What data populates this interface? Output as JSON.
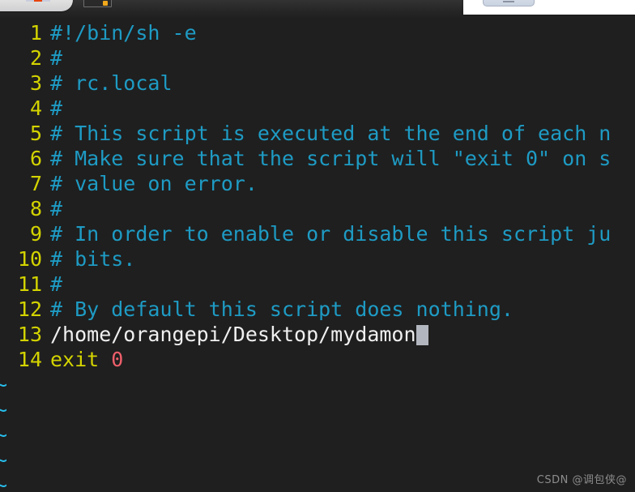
{
  "window": {
    "topbar": {
      "app_tab_name": "application-tab",
      "small_icon_name": "terminal-icon",
      "right_panel_button_name": "minimize-button"
    }
  },
  "editor": {
    "background_color": "#1f1f1f",
    "lineno_color": "#d3d300",
    "comment_color": "#1e9bc4",
    "text_color": "#f0f0f0",
    "keyword_color": "#d3d300",
    "number_color": "#ef5f6b",
    "cursor_color": "#b2b6bf",
    "tilde_color": "#27c0ef",
    "lines": [
      {
        "no": "1",
        "segments": [
          {
            "text": "#!/bin/sh -e",
            "style": "comment"
          }
        ]
      },
      {
        "no": "2",
        "segments": [
          {
            "text": "#",
            "style": "comment"
          }
        ]
      },
      {
        "no": "3",
        "segments": [
          {
            "text": "# rc.local",
            "style": "comment"
          }
        ]
      },
      {
        "no": "4",
        "segments": [
          {
            "text": "#",
            "style": "comment"
          }
        ]
      },
      {
        "no": "5",
        "segments": [
          {
            "text": "# This script is executed at the end of each n",
            "style": "comment"
          }
        ]
      },
      {
        "no": "6",
        "segments": [
          {
            "text": "# Make sure that the script will \"exit 0\" on s",
            "style": "comment"
          }
        ]
      },
      {
        "no": "7",
        "segments": [
          {
            "text": "# value on error.",
            "style": "comment"
          }
        ]
      },
      {
        "no": "8",
        "segments": [
          {
            "text": "#",
            "style": "comment"
          }
        ]
      },
      {
        "no": "9",
        "segments": [
          {
            "text": "# In order to enable or disable this script ju",
            "style": "comment"
          }
        ]
      },
      {
        "no": "10",
        "segments": [
          {
            "text": "# bits.",
            "style": "comment"
          }
        ]
      },
      {
        "no": "11",
        "segments": [
          {
            "text": "#",
            "style": "comment"
          }
        ]
      },
      {
        "no": "12",
        "segments": [
          {
            "text": "# By default this script does nothing.",
            "style": "comment"
          }
        ]
      },
      {
        "no": "13",
        "segments": [
          {
            "text": "/home/orangepi/Desktop/mydamon",
            "style": "plain"
          },
          {
            "text": "",
            "style": "cursor"
          }
        ]
      },
      {
        "no": "14",
        "segments": [
          {
            "text": "exit ",
            "style": "kw"
          },
          {
            "text": "0",
            "style": "num"
          }
        ]
      }
    ],
    "empty_markers": [
      "~",
      "~",
      "~",
      "~",
      "~"
    ]
  },
  "watermark": {
    "text": "CSDN @调包侠@"
  }
}
